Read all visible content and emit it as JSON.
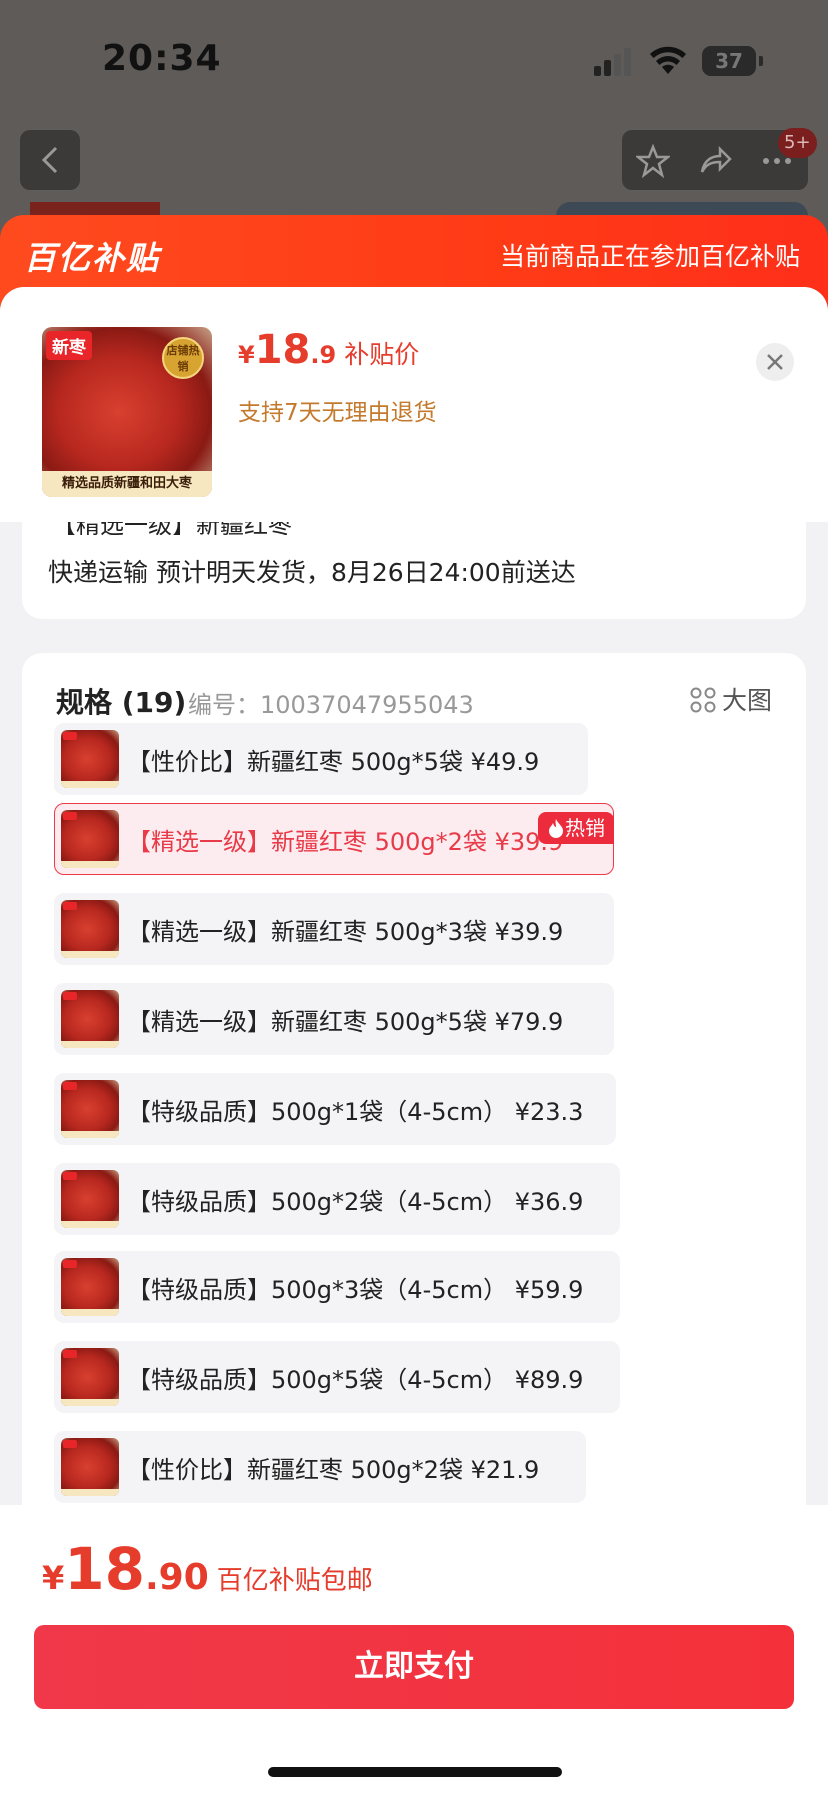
{
  "status_bar": {
    "time": "20:34",
    "battery": "37"
  },
  "nav": {
    "badge": "5+"
  },
  "header": {
    "brand": "百亿补贴",
    "note": "当前商品正在参加百亿补贴"
  },
  "product": {
    "thumb_tag": "新枣",
    "thumb_seal": "店铺热销",
    "thumb_caption": "精选品质新疆和田大枣",
    "price_symbol": "¥",
    "price_int": "18",
    "price_dec": ".9",
    "price_label": "补贴价",
    "return_note": "支持7天无理由退货"
  },
  "shipping": {
    "partial_text": "【精选一级】新疆红枣",
    "text": "快递运输 预计明天发货，8月26日24:00前送达"
  },
  "spec": {
    "title": "规格 (19)",
    "code": "编号：10037047955043",
    "big_view": "大图",
    "hot_badge": "热销",
    "options": [
      {
        "label": "【性价比】新疆红枣 500g*5袋   ¥49.9",
        "selected": false
      },
      {
        "label": "【精选一级】新疆红枣 500g*2袋   ¥39.9",
        "selected": true
      },
      {
        "label": "【精选一级】新疆红枣 500g*3袋   ¥39.9",
        "selected": false
      },
      {
        "label": "【精选一级】新疆红枣 500g*5袋   ¥79.9",
        "selected": false
      },
      {
        "label": "【特级品质】500g*1袋（4-5cm）  ¥23.3",
        "selected": false
      },
      {
        "label": "【特级品质】500g*2袋（4-5cm）  ¥36.9",
        "selected": false
      },
      {
        "label": "【特级品质】500g*3袋（4-5cm）  ¥59.9",
        "selected": false
      },
      {
        "label": "【特级品质】500g*5袋（4-5cm）  ¥89.9",
        "selected": false
      },
      {
        "label": "【性价比】新疆红枣 500g*2袋   ¥21.9",
        "selected": false
      }
    ]
  },
  "footer": {
    "price_symbol": "¥",
    "price_int": "18",
    "price_dec": ".90",
    "price_label": "百亿补贴包邮",
    "pay_button": "立即支付"
  },
  "colors": {
    "brand_red": "#ff3b16",
    "price_red": "#e63c2c",
    "pay_red": "#f0384a",
    "return_orange": "#c47a2c"
  }
}
